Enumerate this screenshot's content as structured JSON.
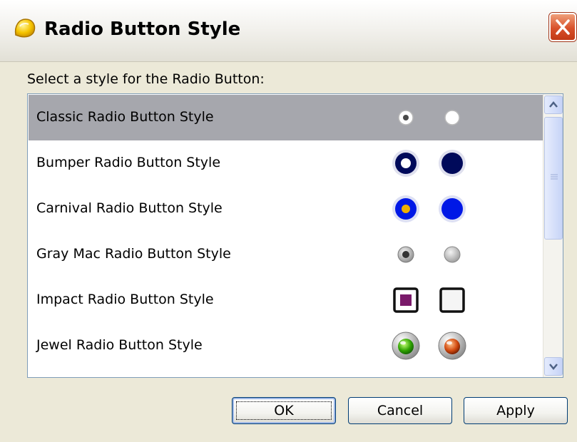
{
  "window": {
    "title": "Radio Button Style"
  },
  "instruction": "Select a style for the Radio Button:",
  "styles": [
    {
      "label": "Classic Radio Button Style",
      "selected": true
    },
    {
      "label": "Bumper Radio Button Style",
      "selected": false
    },
    {
      "label": "Carnival Radio Button Style",
      "selected": false
    },
    {
      "label": "Gray Mac Radio Button Style",
      "selected": false
    },
    {
      "label": "Impact Radio Button Style",
      "selected": false
    },
    {
      "label": "Jewel Radio Button Style",
      "selected": false
    }
  ],
  "buttons": {
    "ok": "OK",
    "cancel": "Cancel",
    "apply": "Apply"
  },
  "colors": {
    "selected_row": "#a6a7ad",
    "bumper_navy": "#000a5a",
    "carnival_blue": "#0018e6",
    "carnival_dot": "#f0b000",
    "impact_purple": "#7a1a6a"
  }
}
